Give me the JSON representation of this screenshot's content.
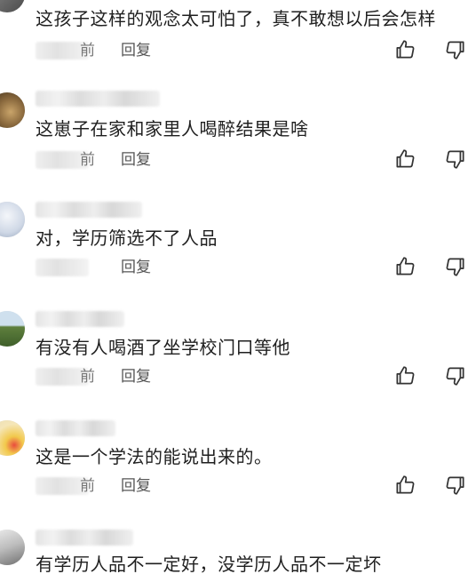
{
  "comments": [
    {
      "text": "这孩子这样的观念太可怕了，真不敢想以后会怎样",
      "time": "前",
      "reply": "回复"
    },
    {
      "text": "这崽子在家和家里人喝醉结果是啥",
      "time": "前",
      "reply": "回复"
    },
    {
      "text": "对，学历筛选不了人品",
      "time": "",
      "reply": "回复"
    },
    {
      "text": "有没有人喝酒了坐学校门口等他",
      "time": "前",
      "reply": "回复"
    },
    {
      "text": "这是一个学法的能说出来的。",
      "time": "前",
      "reply": "回复"
    },
    {
      "text": "有学历人品不一定好，没学历人品不一定坏",
      "time": "",
      "reply": ""
    }
  ],
  "icons": {
    "like": "thumbs-up-icon",
    "dislike": "thumbs-down-icon"
  }
}
